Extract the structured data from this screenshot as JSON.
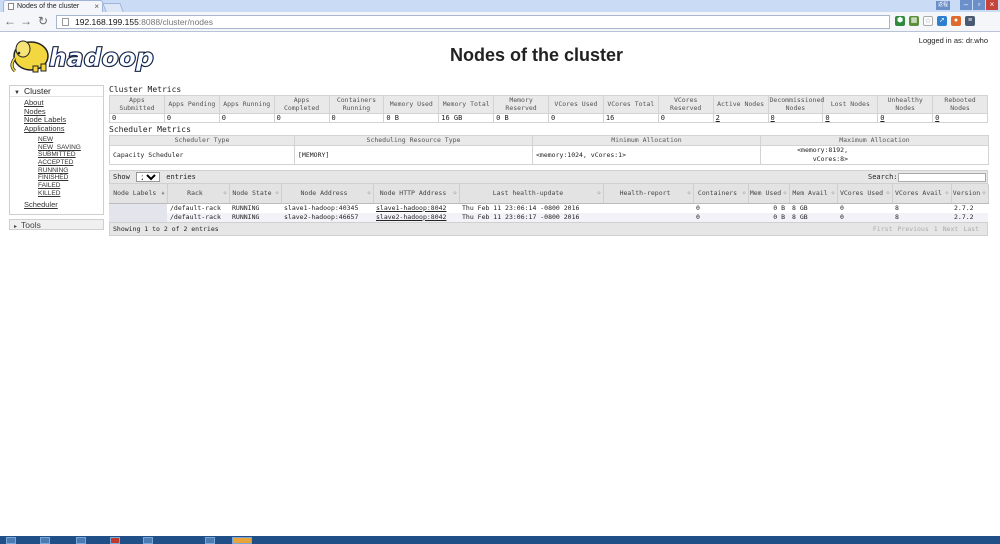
{
  "browser": {
    "tab_title": "Nodes of the cluster",
    "url_host": "192.168.199.155",
    "url_rest": ":8088/cluster/nodes",
    "win_label": "返程"
  },
  "header": {
    "logo_text": "hadoop",
    "logged_in": "Logged in as: dr.who",
    "title": "Nodes of the cluster"
  },
  "sidebar": {
    "cluster_label": "Cluster",
    "links": [
      "About",
      "Nodes",
      "Node Labels",
      "Applications"
    ],
    "app_states": [
      "NEW",
      "NEW_SAVING",
      "SUBMITTED",
      "ACCEPTED",
      "RUNNING",
      "FINISHED",
      "FAILED",
      "KILLED"
    ],
    "scheduler_label": "Scheduler",
    "tools_label": "Tools"
  },
  "cluster_metrics": {
    "title": "Cluster Metrics",
    "headers": [
      "Apps Submitted",
      "Apps Pending",
      "Apps Running",
      "Apps Completed",
      "Containers Running",
      "Memory Used",
      "Memory Total",
      "Memory Reserved",
      "VCores Used",
      "VCores Total",
      "VCores Reserved",
      "Active Nodes",
      "Decommissioned Nodes",
      "Lost Nodes",
      "Unhealthy Nodes",
      "Rebooted Nodes"
    ],
    "values": [
      "0",
      "0",
      "0",
      "0",
      "0",
      "0 B",
      "16 GB",
      "0 B",
      "0",
      "16",
      "0",
      "2",
      "0",
      "0",
      "0",
      "0"
    ]
  },
  "scheduler_metrics": {
    "title": "Scheduler Metrics",
    "headers": [
      "Scheduler Type",
      "Scheduling Resource Type",
      "Minimum Allocation",
      "Maximum Allocation"
    ],
    "values": [
      "Capacity Scheduler",
      "[MEMORY]",
      "<memory:1024, vCores:1>",
      "<memory:8192, vCores:8>"
    ]
  },
  "nodes_table": {
    "show_label": "Show",
    "page_size": "20",
    "entries_label": "entries",
    "search_label": "Search:",
    "headers": [
      "Node Labels",
      "Rack",
      "Node State",
      "Node Address",
      "Node HTTP Address",
      "Last health-update",
      "Health-report",
      "Containers",
      "Mem Used",
      "Mem Avail",
      "VCores Used",
      "VCores Avail",
      "Version"
    ],
    "rows": [
      [
        "",
        "/default-rack",
        "RUNNING",
        "slave1-hadoop:40345",
        "slave1-hadoop:8042",
        "Thu Feb 11 23:06:14 -0800 2016",
        "",
        "0",
        "0 B",
        "8 GB",
        "0",
        "8",
        "2.7.2"
      ],
      [
        "",
        "/default-rack",
        "RUNNING",
        "slave2-hadoop:46657",
        "slave2-hadoop:8042",
        "Thu Feb 11 23:06:17 -0800 2016",
        "",
        "0",
        "0 B",
        "8 GB",
        "0",
        "8",
        "2.7.2"
      ]
    ],
    "info": "Showing 1 to 2 of 2 entries",
    "pager": [
      "First",
      "Previous",
      "1",
      "Next",
      "Last"
    ]
  }
}
